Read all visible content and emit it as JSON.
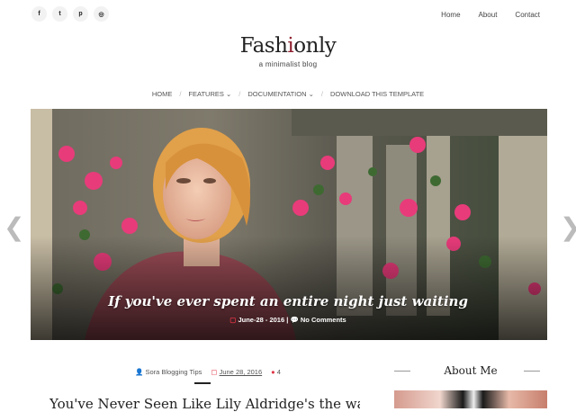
{
  "social": [
    {
      "icon": "facebook-icon",
      "glyph": "f"
    },
    {
      "icon": "twitter-icon",
      "glyph": "t"
    },
    {
      "icon": "pinterest-icon",
      "glyph": "p"
    },
    {
      "icon": "instagram-icon",
      "glyph": "◎"
    }
  ],
  "topnav": {
    "home": "Home",
    "about": "About",
    "contact": "Contact"
  },
  "logo": {
    "text_a": "Fash",
    "text_b": "i",
    "text_c": "only",
    "accent": "#8e1f2d"
  },
  "tagline": "a minimalist blog",
  "mainnav": {
    "home": "Home",
    "features": "Features",
    "documentation": "Documentation",
    "download": "Download This Template"
  },
  "slider": {
    "title": "If you've ever spent an entire night just waiting",
    "date": "June-28 - 2016",
    "separator": "|",
    "comments": "No Comments"
  },
  "post": {
    "author": "Sora Blogging Tips",
    "date": "June 28, 2016",
    "comments": "4",
    "title": "You've Never Seen Like Lily Aldridge's the way"
  },
  "sidebar": {
    "widget_title": "About Me"
  },
  "colors": {
    "accent": "#e03546"
  }
}
